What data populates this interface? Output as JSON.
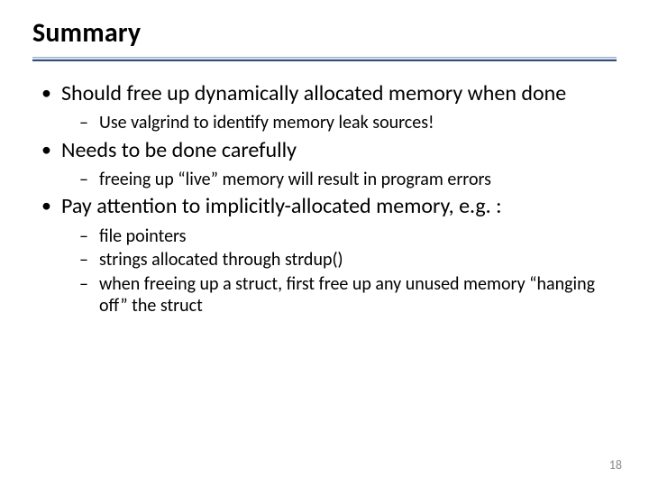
{
  "title": "Summary",
  "bullets": [
    {
      "text": "Should free up dynamically allocated memory when done",
      "sub": [
        "Use valgrind to identify memory leak sources!"
      ]
    },
    {
      "text": "Needs to be done carefully",
      "sub": [
        "freeing up “live” memory will result in program errors"
      ]
    },
    {
      "text": "Pay attention to implicitly-allocated memory, e.g. :",
      "sub": [
        "file pointers",
        "strings allocated through strdup()",
        "when freeing up a struct, first free up any unused memory “hanging off” the struct"
      ]
    }
  ],
  "page_number": "18"
}
